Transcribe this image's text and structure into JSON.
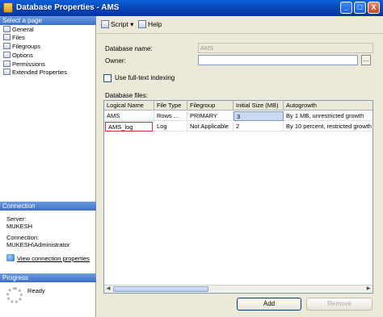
{
  "window": {
    "title": "Database Properties - AMS",
    "minimize_glyph": "_",
    "maximize_glyph": "□",
    "close_glyph": "X"
  },
  "left_pane": {
    "select_page_header": "Select a page",
    "pages": [
      {
        "label": "General",
        "icon": "page-icon"
      },
      {
        "label": "Files",
        "icon": "page-icon"
      },
      {
        "label": "Filegroups",
        "icon": "page-icon"
      },
      {
        "label": "Options",
        "icon": "page-icon"
      },
      {
        "label": "Permissions",
        "icon": "page-icon"
      },
      {
        "label": "Extended Properties",
        "icon": "page-icon"
      }
    ],
    "connection_header": "Connection",
    "server_label": "Server:",
    "server_value": "MUKESH",
    "connection_label": "Connection:",
    "connection_value": "MUKESH\\Administrator",
    "view_connection_link": "View connection properties",
    "progress_header": "Progress",
    "progress_status": "Ready"
  },
  "toolbar": {
    "script_label": "Script",
    "help_label": "Help"
  },
  "form": {
    "database_name_label": "Database name:",
    "database_name_value": "AMS",
    "owner_label": "Owner:",
    "owner_value": "",
    "ellipsis_label": "...",
    "fulltext_label": "Use full-text indexing",
    "fulltext_checked": false,
    "database_files_label": "Database files:"
  },
  "grid": {
    "columns": [
      "Logical Name",
      "File Type",
      "Filegroup",
      "Initial Size (MB)",
      "Autogrowth"
    ],
    "rows": [
      [
        "AMS",
        "Rows ...",
        "PRIMARY",
        "3",
        "By 1 MB, unrestricted growth"
      ],
      [
        "AMS_log",
        "Log",
        "Not Applicable",
        "2",
        "By 10 percent, restricted growth t"
      ]
    ]
  },
  "buttons": {
    "add_label": "Add",
    "remove_label": "Remove"
  },
  "colors": {
    "titlebar": "#0842b0",
    "section_header": "#3c70c8",
    "selection": "#c9d9f2",
    "edit_border": "#d03030"
  }
}
